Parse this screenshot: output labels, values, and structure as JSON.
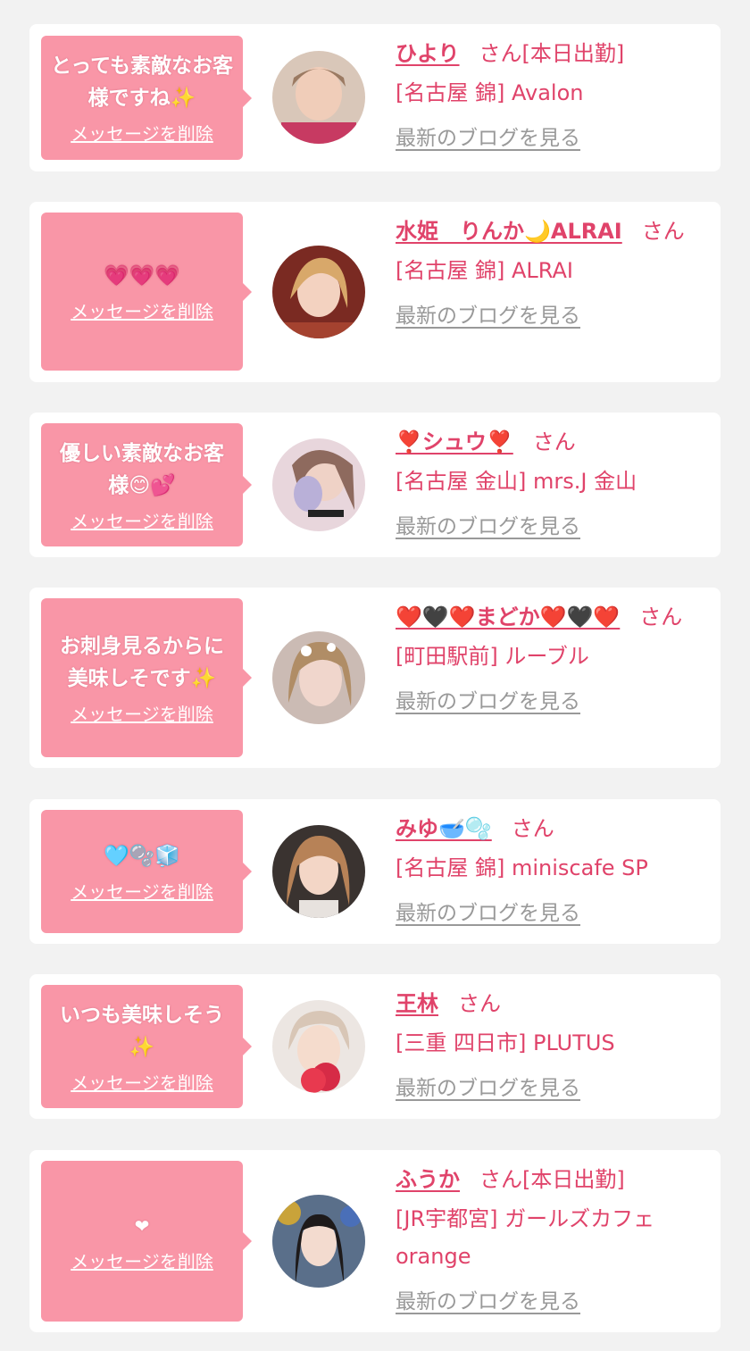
{
  "delete_label": "メッセージを削除",
  "blog_label": "最新のブログを見る",
  "honorific": "さん",
  "colors": {
    "accent": "#e0436a",
    "bubble": "#f996a7",
    "link_gray": "#999999",
    "background": "#f2f2f2"
  },
  "favorites": [
    {
      "message": "とっても素敵なお客様ですね✨",
      "name": "ひより",
      "status": "[本日出勤]",
      "shop": "[名古屋 錦] Avalon"
    },
    {
      "message": "💗💗💗",
      "name": "水姫　りんか🌙ALRAI",
      "status": "",
      "shop": "[名古屋 錦] ALRAI"
    },
    {
      "message": "優しい素敵なお客様😊💕",
      "name": "❣️シュウ❣️",
      "status": "",
      "shop": "[名古屋 金山] mrs.J 金山"
    },
    {
      "message": "お刺身見るからに美味しそです✨",
      "name": "❤️🖤❤️まどか❤️🖤❤️",
      "status": "",
      "shop": "[町田駅前] ルーブル"
    },
    {
      "message": "🩵🫧🧊",
      "name": "みゆ🥣🫧",
      "status": "",
      "shop": "[名古屋 錦] miniscafe SP"
    },
    {
      "message": "いつも美味しそう✨",
      "name": "王林",
      "status": "",
      "shop": "[三重 四日市] PLUTUS"
    },
    {
      "message": "❤",
      "name": "ふうか",
      "status": "[本日出勤]",
      "shop": "[JR宇都宮] ガールズカフェ orange"
    }
  ]
}
